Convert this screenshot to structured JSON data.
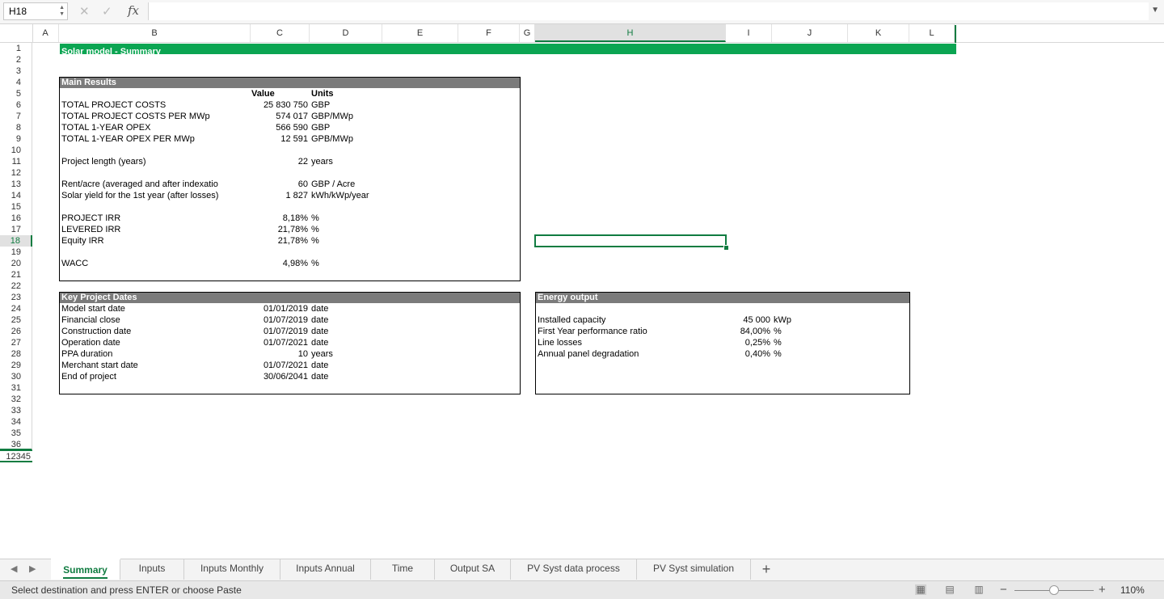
{
  "formula_bar": {
    "name_box": "H18",
    "cancel_icon": "✕",
    "enter_icon": "✓",
    "fx_label": "fx",
    "formula": ""
  },
  "columns": [
    {
      "label": "A",
      "selected": false
    },
    {
      "label": "B",
      "selected": false
    },
    {
      "label": "C",
      "selected": false
    },
    {
      "label": "D",
      "selected": false
    },
    {
      "label": "E",
      "selected": false
    },
    {
      "label": "F",
      "selected": false
    },
    {
      "label": "G",
      "selected": false
    },
    {
      "label": "H",
      "selected": true
    },
    {
      "label": "I",
      "selected": false
    },
    {
      "label": "J",
      "selected": false
    },
    {
      "label": "K",
      "selected": false
    },
    {
      "label": "L",
      "selected": false
    }
  ],
  "rows": [
    "1",
    "2",
    "3",
    "4",
    "5",
    "6",
    "7",
    "8",
    "9",
    "10",
    "11",
    "12",
    "13",
    "14",
    "15",
    "16",
    "17",
    "18",
    "19",
    "20",
    "21",
    "22",
    "23",
    "24",
    "25",
    "26",
    "27",
    "28",
    "29",
    "30",
    "31",
    "32",
    "33",
    "34",
    "35",
    "36"
  ],
  "selected_row": "18",
  "extra_row_label": "12345",
  "sheet": {
    "title": "Solar model - Summary",
    "main_results": {
      "header": "Main Results",
      "col_value": "Value",
      "col_units": "Units",
      "items": [
        {
          "label": "TOTAL PROJECT COSTS",
          "value": "25 830 750",
          "unit": "GBP"
        },
        {
          "label": "TOTAL PROJECT COSTS PER MWp",
          "value": "574 017",
          "unit": "GBP/MWp"
        },
        {
          "label": "TOTAL 1-YEAR OPEX",
          "value": "566 590",
          "unit": "GBP"
        },
        {
          "label": "TOTAL 1-YEAR OPEX PER MWp",
          "value": "12 591",
          "unit": "GPB/MWp"
        },
        {
          "label": "Project length (years)",
          "value": "22",
          "unit": "years"
        },
        {
          "label": "Rent/acre (averaged and after indexatio",
          "value": "60",
          "unit": "GBP / Acre"
        },
        {
          "label": "Solar yield for the 1st year (after losses)",
          "value": "1 827",
          "unit": "kWh/kWp/year"
        },
        {
          "label": "PROJECT IRR",
          "value": "8,18%",
          "unit": "%"
        },
        {
          "label": "LEVERED IRR",
          "value": "21,78%",
          "unit": "%"
        },
        {
          "label": "Equity IRR",
          "value": "21,78%",
          "unit": "%"
        },
        {
          "label": "WACC",
          "value": "4,98%",
          "unit": "%"
        }
      ]
    },
    "key_dates": {
      "header": "Key Project Dates",
      "items": [
        {
          "label": "Model start date",
          "value": "01/01/2019",
          "unit": "date"
        },
        {
          "label": "Financial close",
          "value": "01/07/2019",
          "unit": "date"
        },
        {
          "label": "Construction date",
          "value": "01/07/2019",
          "unit": "date"
        },
        {
          "label": "Operation date",
          "value": "01/07/2021",
          "unit": "date"
        },
        {
          "label": "PPA duration",
          "value": "10",
          "unit": "years"
        },
        {
          "label": "Merchant start date",
          "value": "01/07/2021",
          "unit": "date"
        },
        {
          "label": "End of project",
          "value": "30/06/2041",
          "unit": "date"
        }
      ]
    },
    "energy_output": {
      "header": "Energy output",
      "items": [
        {
          "label": "Installed capacity",
          "value": "45 000",
          "unit": "kWp"
        },
        {
          "label": "First Year performance ratio",
          "value": "84,00%",
          "unit": "%"
        },
        {
          "label": "Line losses",
          "value": "0,25%",
          "unit": "%"
        },
        {
          "label": "Annual panel degradation",
          "value": "0,40%",
          "unit": "%"
        }
      ]
    }
  },
  "tabs": [
    "Summary",
    "Inputs",
    "Inputs Monthly",
    "Inputs Annual",
    "Time",
    "Output SA",
    "PV Syst data process",
    "PV Syst simulation"
  ],
  "active_tab": "Summary",
  "add_sheet_label": "+",
  "status": {
    "message": "Select destination and press ENTER or choose Paste",
    "zoom": "110%",
    "zoom_minus": "−",
    "zoom_plus": "+"
  },
  "colors": {
    "accent": "#107c41",
    "title_band": "#0ba552",
    "box_header": "#7b7b7b"
  }
}
